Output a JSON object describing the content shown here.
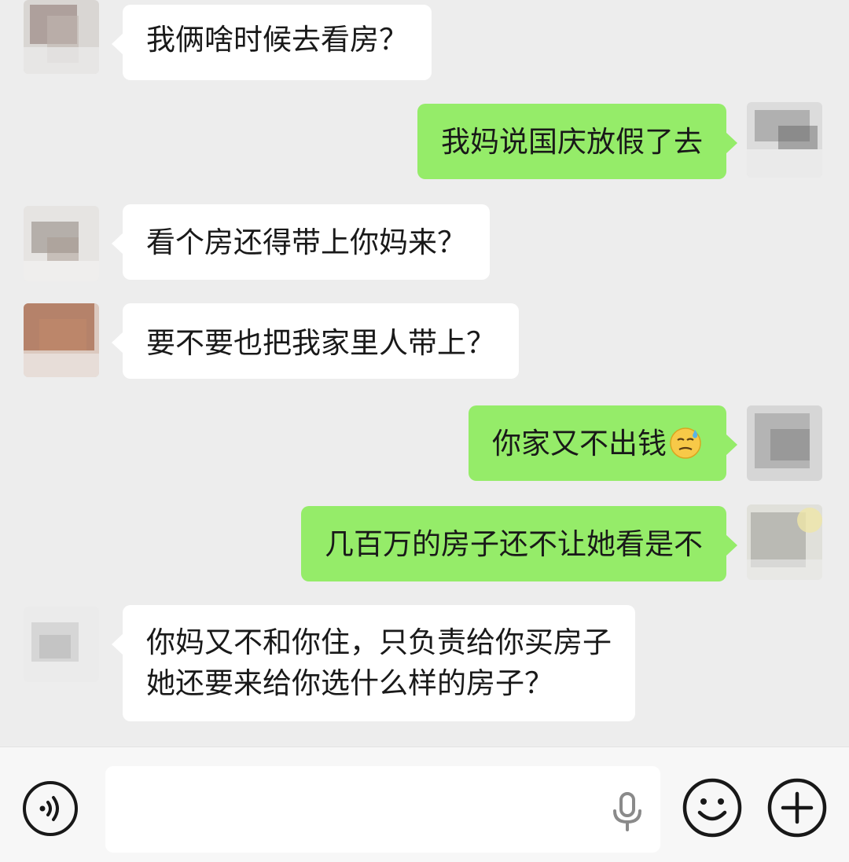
{
  "messages": [
    {
      "side": "in",
      "text": "我俩啥时候去看房？"
    },
    {
      "side": "out",
      "text": "我妈说国庆放假了去"
    },
    {
      "side": "in",
      "text": "看个房还得带上你妈来？"
    },
    {
      "side": "in",
      "text": "要不要也把我家里人带上？"
    },
    {
      "side": "out",
      "text": "你家又不出钱",
      "emoji": "sweat-smile-emoji"
    },
    {
      "side": "out",
      "text": "几百万的房子还不让她看是不"
    },
    {
      "side": "in",
      "lines": [
        "你妈又不和你住，只负责给你买房子",
        "她还要来给你选什么样的房子？"
      ]
    }
  ],
  "input_bar": {
    "placeholder": "",
    "value": "",
    "icons": [
      "voice-icon",
      "microphone-icon",
      "emoji-icon",
      "plus-icon"
    ]
  },
  "colors": {
    "background": "#ededed",
    "incoming_bubble": "#ffffff",
    "outgoing_bubble": "#95ec69",
    "input_bar": "#f7f7f7"
  }
}
